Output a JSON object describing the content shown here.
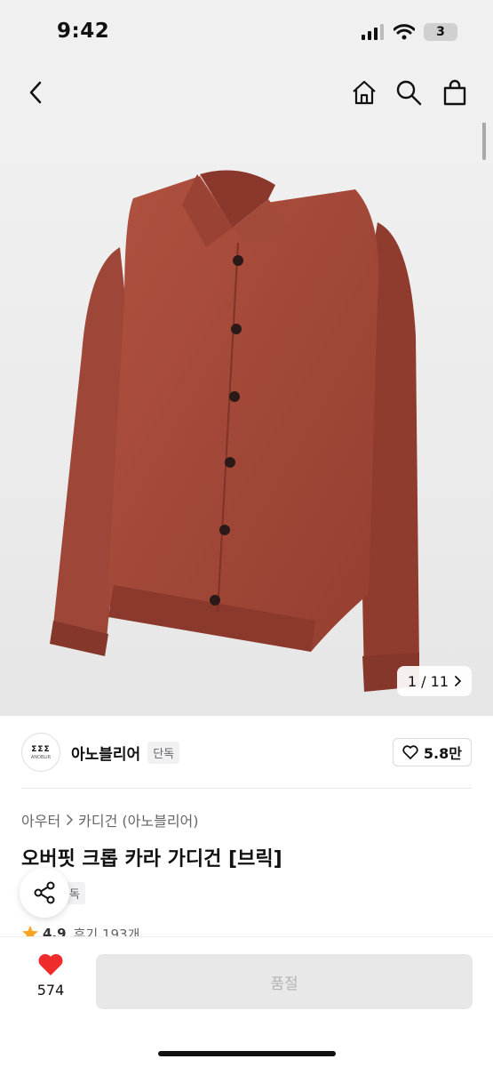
{
  "status_bar": {
    "time": "9:42",
    "battery": "3"
  },
  "image": {
    "counter": "1 / 11"
  },
  "brand": {
    "logo_mark": "ΣΣΣ",
    "logo_word": "ANOBLIR",
    "name": "아노블리어",
    "tag": "단독",
    "likes": "5.8만"
  },
  "breadcrumb": {
    "level1": "아우터",
    "level2": "카디건 (아노블리어)"
  },
  "product": {
    "title": "오버핏 크롭 카라 가디건 [브릭]",
    "tag": "단독",
    "rating": "4.9",
    "reviews": "후기 193개"
  },
  "bottom": {
    "wish_count": "574",
    "buy_label": "품절"
  },
  "colors": {
    "heart": "#ef2b2b",
    "star": "#f6a623",
    "cardigan": "#a44a3b"
  }
}
